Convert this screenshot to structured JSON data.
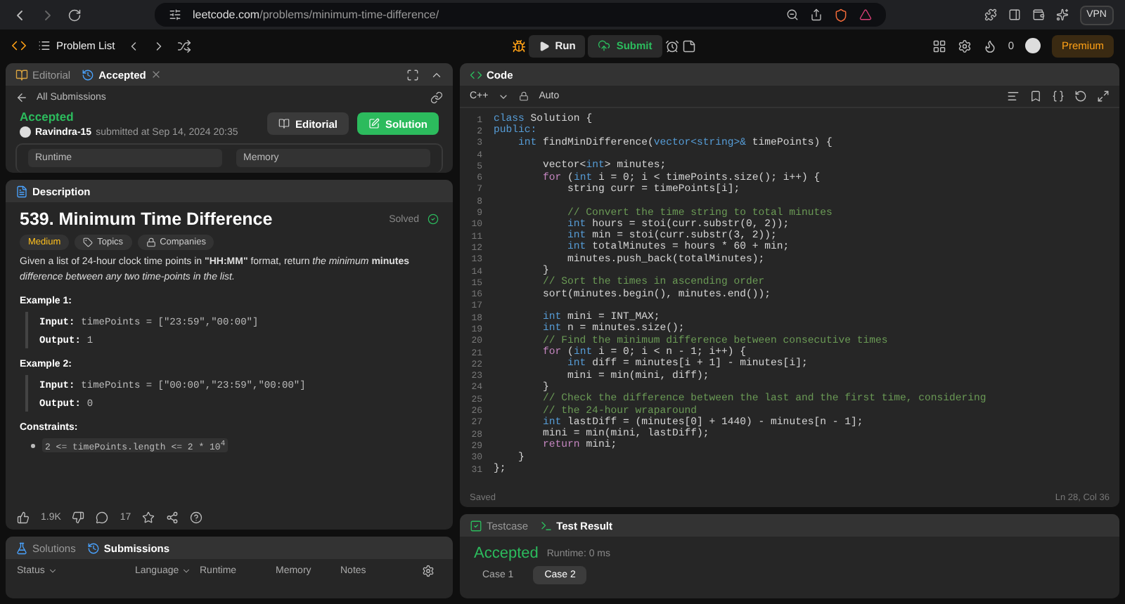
{
  "browser": {
    "url_host": "leetcode.com",
    "url_path": "/problems/minimum-time-difference/",
    "vpn": "VPN"
  },
  "nav": {
    "problem_list": "Problem List",
    "run": "Run",
    "submit": "Submit",
    "streak": "0",
    "premium": "Premium"
  },
  "submission_panel": {
    "tabs": [
      {
        "label": "Editorial",
        "selected": false
      },
      {
        "label": "Accepted",
        "selected": true
      }
    ],
    "back_link": "All Submissions",
    "status": "Accepted",
    "user": "Ravindra-15",
    "submitted": "submitted at Sep 14, 2024 20:35",
    "buttons": [
      {
        "label": "Editorial",
        "kind": "secondary"
      },
      {
        "label": "Solution",
        "kind": "primary"
      }
    ],
    "metrics": [
      "Runtime",
      "Memory"
    ]
  },
  "description": {
    "tab": "Description",
    "title": "539. Minimum Time Difference",
    "solved": "Solved",
    "tags": [
      {
        "label": "Medium",
        "kind": "difficulty"
      },
      {
        "label": "Topics",
        "kind": "topics"
      },
      {
        "label": "Companies",
        "kind": "companies"
      }
    ],
    "statement": "Given a list of 24-hour clock time points in **\"HH:MM\"** format, return *the minimum* **minutes** *difference between any two time-points in the list.*",
    "examples": [
      {
        "heading": "Example 1:",
        "input_label": "Input:",
        "input": "timePoints = [\"23:59\",\"00:00\"]",
        "output_label": "Output:",
        "output": "1"
      },
      {
        "heading": "Example 2:",
        "input_label": "Input:",
        "input": "timePoints = [\"00:00\",\"23:59\",\"00:00\"]",
        "output_label": "Output:",
        "output": "0"
      }
    ],
    "constraints_heading": "Constraints:",
    "constraints": [
      "2 <= timePoints.length <= 2 * 10$^{4}$"
    ],
    "likes": "1.9K",
    "comments": "17"
  },
  "submissions_panel": {
    "tabs": [
      {
        "label": "Solutions",
        "selected": false
      },
      {
        "label": "Submissions",
        "selected": true
      }
    ],
    "columns": [
      {
        "label": "Status",
        "dropdown": true
      },
      {
        "label": "Language",
        "dropdown": true
      },
      {
        "label": "Runtime",
        "dropdown": false
      },
      {
        "label": "Memory",
        "dropdown": false
      },
      {
        "label": "Notes",
        "dropdown": false
      }
    ]
  },
  "code_panel": {
    "title": "Code",
    "language": "C++",
    "mode": "Auto",
    "lines": [
      {
        "number": "1",
        "tokens": [
          {
            "kind": "keyword",
            "text": "class"
          },
          {
            "kind": "plain",
            "text": " Solution {"
          }
        ]
      },
      {
        "number": "2",
        "tokens": [
          {
            "kind": "keyword",
            "text": "public:"
          }
        ]
      },
      {
        "number": "3",
        "tokens": [
          {
            "kind": "keyword",
            "text": "    int"
          },
          {
            "kind": "plain",
            "text": " findMinDifference("
          },
          {
            "kind": "keyword",
            "text": "vector<string>&"
          },
          {
            "kind": "plain",
            "text": " timePoints) {"
          }
        ]
      },
      {
        "number": "4"
      },
      {
        "number": "5",
        "tokens": [
          {
            "kind": "plain",
            "text": "        vector<"
          },
          {
            "kind": "keyword",
            "text": "int"
          },
          {
            "kind": "plain",
            "text": "> minutes;"
          }
        ]
      },
      {
        "number": "6",
        "tokens": [
          {
            "kind": "control",
            "text": "        for"
          },
          {
            "kind": "plain",
            "text": " ("
          },
          {
            "kind": "keyword",
            "text": "int"
          },
          {
            "kind": "plain",
            "text": " i = 0; i < timePoints.size(); i++) {"
          }
        ]
      },
      {
        "number": "7",
        "tokens": [
          {
            "kind": "plain",
            "text": "            string curr = timePoints[i];"
          }
        ]
      },
      {
        "number": "8"
      },
      {
        "number": "9",
        "tokens": [
          {
            "kind": "comment",
            "text": "            // Convert the time string to total minutes"
          }
        ]
      },
      {
        "number": "10",
        "tokens": [
          {
            "kind": "keyword",
            "text": "            int"
          },
          {
            "kind": "plain",
            "text": " hours = stoi(curr.substr(0, 2));"
          }
        ]
      },
      {
        "number": "11",
        "tokens": [
          {
            "kind": "keyword",
            "text": "            int"
          },
          {
            "kind": "plain",
            "text": " min = stoi(curr.substr(3, 2));"
          }
        ]
      },
      {
        "number": "12",
        "tokens": [
          {
            "kind": "keyword",
            "text": "            int"
          },
          {
            "kind": "plain",
            "text": " totalMinutes = hours * 60 + min;"
          }
        ]
      },
      {
        "number": "13",
        "tokens": [
          {
            "kind": "plain",
            "text": "            minutes.push_back(totalMinutes);"
          }
        ]
      },
      {
        "number": "14",
        "tokens": [
          {
            "kind": "plain",
            "text": "        }"
          }
        ]
      },
      {
        "number": "15",
        "tokens": [
          {
            "kind": "comment",
            "text": "        // Sort the times in ascending order"
          }
        ]
      },
      {
        "number": "16",
        "tokens": [
          {
            "kind": "plain",
            "text": "        sort(minutes.begin(), minutes.end());"
          }
        ]
      },
      {
        "number": "17"
      },
      {
        "number": "18",
        "tokens": [
          {
            "kind": "keyword",
            "text": "        int"
          },
          {
            "kind": "plain",
            "text": " mini = INT_MAX;"
          }
        ]
      },
      {
        "number": "19",
        "tokens": [
          {
            "kind": "keyword",
            "text": "        int"
          },
          {
            "kind": "plain",
            "text": " n = minutes.size();"
          }
        ]
      },
      {
        "number": "20",
        "tokens": [
          {
            "kind": "comment",
            "text": "        // Find the minimum difference between consecutive times"
          }
        ]
      },
      {
        "number": "21",
        "tokens": [
          {
            "kind": "control",
            "text": "        for"
          },
          {
            "kind": "plain",
            "text": " ("
          },
          {
            "kind": "keyword",
            "text": "int"
          },
          {
            "kind": "plain",
            "text": " i = 0; i < n - 1; i++) {"
          }
        ]
      },
      {
        "number": "22",
        "tokens": [
          {
            "kind": "keyword",
            "text": "            int"
          },
          {
            "kind": "plain",
            "text": " diff = minutes[i + 1] - minutes[i];"
          }
        ]
      },
      {
        "number": "23",
        "tokens": [
          {
            "kind": "plain",
            "text": "            mini = min(mini, diff);"
          }
        ]
      },
      {
        "number": "24",
        "tokens": [
          {
            "kind": "plain",
            "text": "        }"
          }
        ]
      },
      {
        "number": "25",
        "tokens": [
          {
            "kind": "comment",
            "text": "        // Check the difference between the last and the first time, considering"
          }
        ]
      },
      {
        "number": "26",
        "tokens": [
          {
            "kind": "comment",
            "text": "        // the 24-hour wraparound"
          }
        ]
      },
      {
        "number": "27",
        "tokens": [
          {
            "kind": "keyword",
            "text": "        int"
          },
          {
            "kind": "plain",
            "text": " lastDiff = (minutes[0] + 1440) - minutes[n - 1];"
          }
        ]
      },
      {
        "number": "28",
        "tokens": [
          {
            "kind": "plain",
            "text": "        mini = min(mini, lastDiff);"
          }
        ]
      },
      {
        "number": "29",
        "tokens": [
          {
            "kind": "control",
            "text": "        return"
          },
          {
            "kind": "plain",
            "text": " mini;"
          }
        ]
      },
      {
        "number": "30",
        "tokens": [
          {
            "kind": "plain",
            "text": "    }"
          }
        ]
      },
      {
        "number": "31",
        "tokens": [
          {
            "kind": "plain",
            "text": "};"
          }
        ]
      }
    ],
    "status": "Saved",
    "cursor": "Ln 28, Col 36"
  },
  "result_panel": {
    "tabs": [
      {
        "label": "Testcase",
        "selected": false
      },
      {
        "label": "Test Result",
        "selected": true
      }
    ],
    "verdict": "Accepted",
    "runtime": "Runtime: 0 ms",
    "cases": [
      {
        "label": "Case 1",
        "selected": false
      },
      {
        "label": "Case 2",
        "selected": true
      }
    ]
  }
}
